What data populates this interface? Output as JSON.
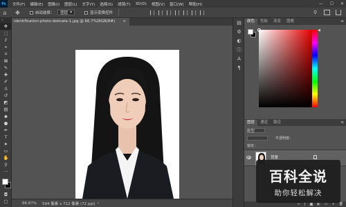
{
  "app": {
    "logo": "Ps"
  },
  "menu": [
    "文件(F)",
    "编辑(E)",
    "图像(I)",
    "图层(L)",
    "文字(Y)",
    "选择(S)",
    "滤镜(T)",
    "3D(D)",
    "视图(V)",
    "窗口(W)",
    "帮助(H)"
  ],
  "window_controls": [
    "—",
    "☐",
    "✕"
  ],
  "options": {
    "auto_select_label": "自动选择：",
    "auto_select_value": "图层",
    "transform_label": "显示变换控件"
  },
  "document_tab": {
    "title": "identification-photo-delicate-1.jpg @ 66.7%(RGB/8#)",
    "close": "×"
  },
  "status": {
    "zoom": "66.67%",
    "doc_info": "594 像素 x 712 像素 (72 ppi)",
    "arrow": "›"
  },
  "color_panel": {
    "tabs": [
      "颜色",
      "色板",
      "渐变",
      "图案"
    ],
    "menu": "≡"
  },
  "layers_panel": {
    "tabs": [
      "图层",
      "通道",
      "路径"
    ],
    "menu": "≡",
    "kind_label": "类型",
    "opacity_label": "不透明度：",
    "lock_label": "锁定：",
    "layer_name": "背景"
  },
  "watermark": {
    "title": "百科全说",
    "subtitle": "助你轻松解决"
  },
  "colors": {
    "foreground": "#ffffff",
    "background": "#000000",
    "accent": "#31a8ff"
  },
  "icons": [
    "home-icon",
    "move-icon",
    "search-icon",
    "workspace-icon",
    "share-icon",
    "eye-icon",
    "lock-icon"
  ]
}
